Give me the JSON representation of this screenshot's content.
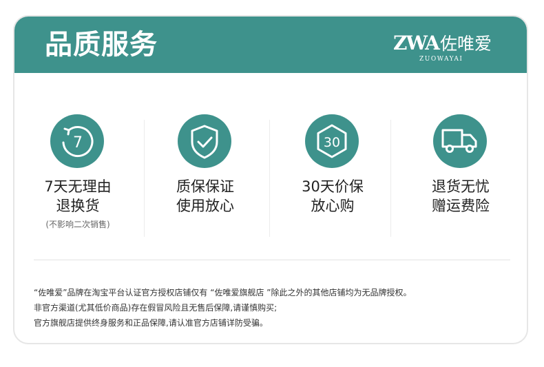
{
  "header": {
    "title": "品质服务",
    "brand_mark": "ZWA",
    "brand_name": "佐唯爱",
    "brand_pinyin": "ZUOWAYAI",
    "bg_color": "#3e928c"
  },
  "features": [
    {
      "icon": "seven-day-return-icon",
      "icon_text": "7",
      "line1": "7天无理由",
      "line2": "退换货",
      "note": "(不影响二次销售)"
    },
    {
      "icon": "shield-check-icon",
      "line1": "质保保证",
      "line2": "使用放心"
    },
    {
      "icon": "hexagon-30-icon",
      "icon_text": "30",
      "line1": "30天价保",
      "line2": "放心购"
    },
    {
      "icon": "delivery-truck-icon",
      "line1": "退货无忧",
      "line2": "赠运费险"
    }
  ],
  "notice": {
    "line1": "“佐唯爱”品牌在淘宝平台认证官方授权店铺仅有 “佐唯爱旗舰店 ”除此之外的其他店铺均为无品牌授权。",
    "line2": "非官方渠道(尤其低价商品)存在假冒风险且无售后保障,请谨慎购买;",
    "line3": "官方旗舰店提供终身服务和正品保障,请认准官方店铺详防受骗。"
  }
}
